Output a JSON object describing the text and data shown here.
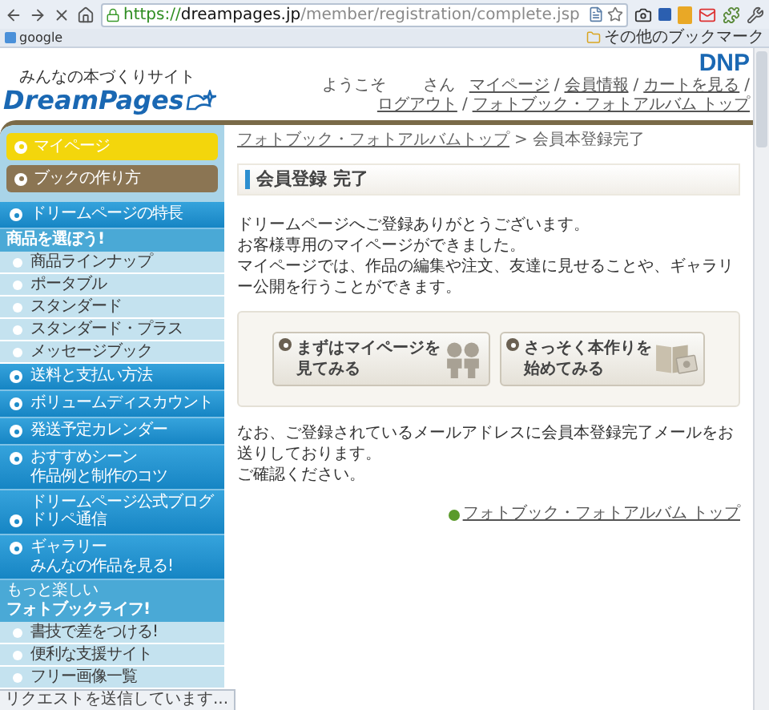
{
  "browser": {
    "url_scheme": "https://",
    "url_host": "dreampages.jp",
    "url_path": "/member/registration/complete.jsp",
    "bookmarks": [
      {
        "label": "google"
      }
    ],
    "other_bookmarks": "その他のブックマーク",
    "status": "リクエストを送信しています..."
  },
  "header": {
    "tagline": "みんなの本づくりサイト",
    "logo": "DreamPages",
    "brand": "DNP",
    "welcome": "ようこそ",
    "honorific": "さん",
    "separator": "/",
    "nav": [
      "マイページ",
      "会員情報",
      "カートを見る",
      "ログアウト",
      "フォトブック・フォトアルバム トップ"
    ]
  },
  "sidebar": [
    {
      "kind": "yellow",
      "label": "マイページ"
    },
    {
      "kind": "brown",
      "label": "ブックの作り方"
    },
    {
      "kind": "blue",
      "label": "ドリームページの特長"
    },
    {
      "kind": "section",
      "label": "商品を選ぼう!"
    },
    {
      "kind": "sub",
      "label": "商品ラインナップ"
    },
    {
      "kind": "sub",
      "label": "ポータブル"
    },
    {
      "kind": "sub",
      "label": "スタンダード"
    },
    {
      "kind": "sub",
      "label": "スタンダード・プラス"
    },
    {
      "kind": "sub",
      "label": "メッセージブック"
    },
    {
      "kind": "blue",
      "label": "送料と支払い方法"
    },
    {
      "kind": "blue",
      "label": "ボリュームディスカウント"
    },
    {
      "kind": "blue",
      "label": "発送予定カレンダー"
    },
    {
      "kind": "blue",
      "label": "おすすめシーン",
      "note": "作品例と制作のコツ"
    },
    {
      "kind": "blue",
      "pre": "ドリームページ公式ブログ",
      "label": "ドリペ通信"
    },
    {
      "kind": "blue",
      "label": "ギャラリー",
      "note": "みんなの作品を見る!"
    },
    {
      "kind": "section",
      "lead": "もっと楽しい",
      "label": "フォトブックライフ!"
    },
    {
      "kind": "sub",
      "label": "書技で差をつける!"
    },
    {
      "kind": "sub",
      "label": "便利な支援サイト"
    },
    {
      "kind": "sub",
      "label": "フリー画像一覧"
    }
  ],
  "main": {
    "breadcrumb": {
      "link": "フォトブック・フォトアルバムトップ",
      "separator": ">",
      "current": "会員本登録完了"
    },
    "title": "会員登録 完了",
    "message": [
      "ドリームページへご登録ありがとうございます。",
      "お客様専用のマイページができました。",
      "マイページでは、作品の編集や注文、友達に見せることや、ギャラリー公開を行うことができます。"
    ],
    "actions": [
      {
        "kind": "people",
        "lines": [
          "まずはマイページを",
          "見てみる"
        ]
      },
      {
        "kind": "book",
        "lines": [
          "さっそく本作りを",
          "始めてみる"
        ]
      }
    ],
    "note": [
      "なお、ご登録されているメールアドレスに会員本登録完了メールをお送りしております。",
      "ご確認ください。"
    ],
    "top_link": "フォトブック・フォトアルバム トップ"
  }
}
